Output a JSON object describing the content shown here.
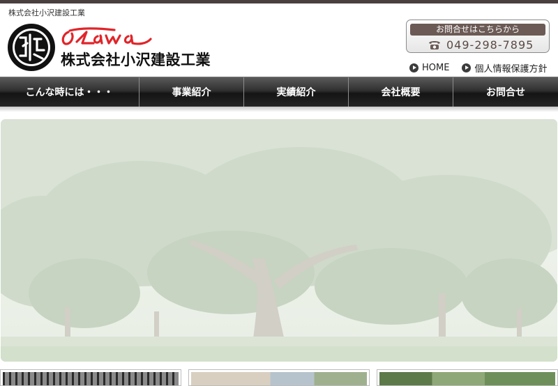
{
  "header": {
    "tagline": "株式会社小沢建設工業",
    "company_name": "株式会社小沢建設工業",
    "brand_script": "Ozawa"
  },
  "contact": {
    "label": "お問合せはこちらから",
    "phone": "049-298-7895"
  },
  "util_links": [
    {
      "label": "HOME"
    },
    {
      "label": "個人情報保護方針"
    }
  ],
  "nav": [
    {
      "label": "こんな時には・・・"
    },
    {
      "label": "事業紹介"
    },
    {
      "label": "実績紹介"
    },
    {
      "label": "会社概要"
    },
    {
      "label": "お問合せ"
    }
  ],
  "colors": {
    "brand_red": "#e0252a",
    "nav_dark": "#1a1a1a",
    "contact_label_bg": "#6b5a55"
  }
}
